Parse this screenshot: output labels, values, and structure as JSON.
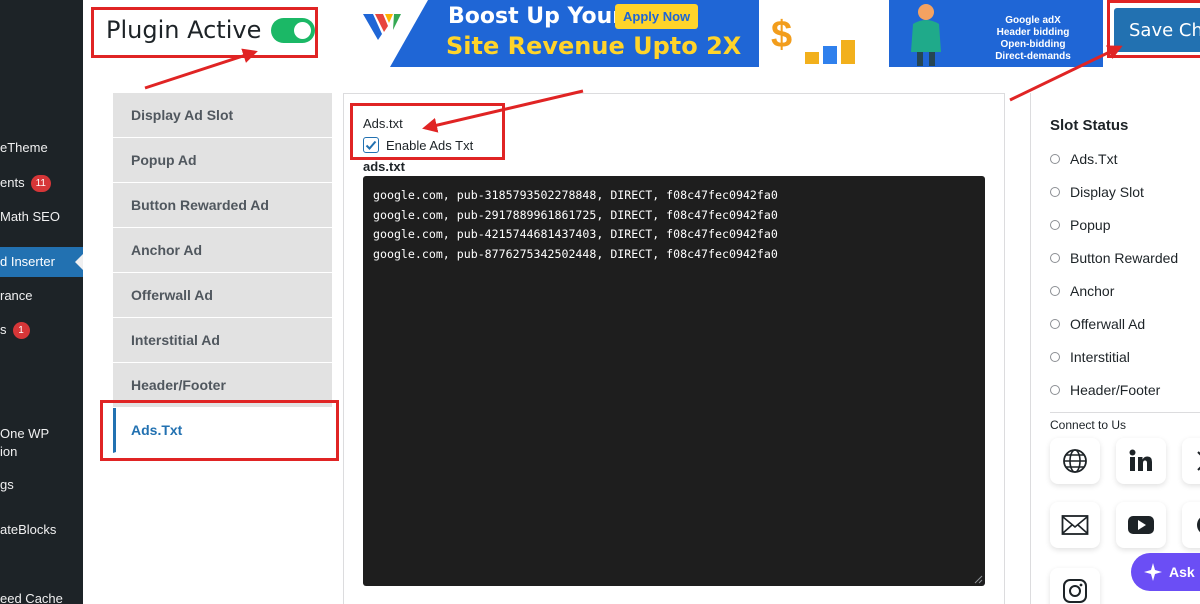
{
  "wp_menu": {
    "items": [
      {
        "label": "eTheme"
      },
      {
        "label": "ents",
        "badge": "11"
      },
      {
        "label": "Math SEO"
      },
      {
        "label": "d Inserter",
        "current": true
      },
      {
        "label": "rance"
      },
      {
        "label": "s",
        "badge": "1"
      },
      {
        "label": "One WP ion"
      },
      {
        "label": "gs"
      },
      {
        "label": "ateBlocks"
      },
      {
        "label": "eed Cache"
      }
    ]
  },
  "header": {
    "plugin_active_label": "Plugin Active",
    "plugin_active": true,
    "save_button": "Save Cha"
  },
  "banner": {
    "line1": "Boost Up Your",
    "apply": "Apply Now",
    "line2": "Site Revenue Upto 2X",
    "dollar": "$",
    "features": [
      "Google adX",
      "Header bidding",
      "Open-bidding",
      "Direct-demands"
    ]
  },
  "tabs": [
    {
      "label": "Display Ad Slot"
    },
    {
      "label": "Popup Ad"
    },
    {
      "label": "Button Rewarded Ad"
    },
    {
      "label": "Anchor Ad"
    },
    {
      "label": "Offerwall Ad"
    },
    {
      "label": "Interstitial Ad"
    },
    {
      "label": "Header/Footer"
    },
    {
      "label": "Ads.Txt",
      "active": true
    }
  ],
  "content": {
    "title": "Ads.txt",
    "enable_label": "Enable Ads Txt",
    "enable_checked": true,
    "file_label": "ads.txt",
    "lines": "google.com, pub-3185793502278848, DIRECT, f08c47fec0942fa0\ngoogle.com, pub-2917889961861725, DIRECT, f08c47fec0942fa0\ngoogle.com, pub-4215744681437403, DIRECT, f08c47fec0942fa0\ngoogle.com, pub-8776275342502448, DIRECT, f08c47fec0942fa0"
  },
  "sidebar": {
    "title": "Slot Status",
    "slots": [
      "Ads.Txt",
      "Display Slot",
      "Popup",
      "Button Rewarded",
      "Anchor",
      "Offerwall Ad",
      "Interstitial",
      "Header/Footer"
    ],
    "connect_label": "Connect to Us",
    "social_icons": [
      "globe-icon",
      "linkedin-icon",
      "x-icon",
      "mail-icon",
      "youtube-icon",
      "instagram-icon"
    ],
    "ask_label": "Ask"
  },
  "colors": {
    "accent": "#2271b1",
    "toggle_on": "#1bb866",
    "annotation": "#e02424",
    "banner_blue": "#1f66d6",
    "banner_yellow": "#ffd42a"
  }
}
